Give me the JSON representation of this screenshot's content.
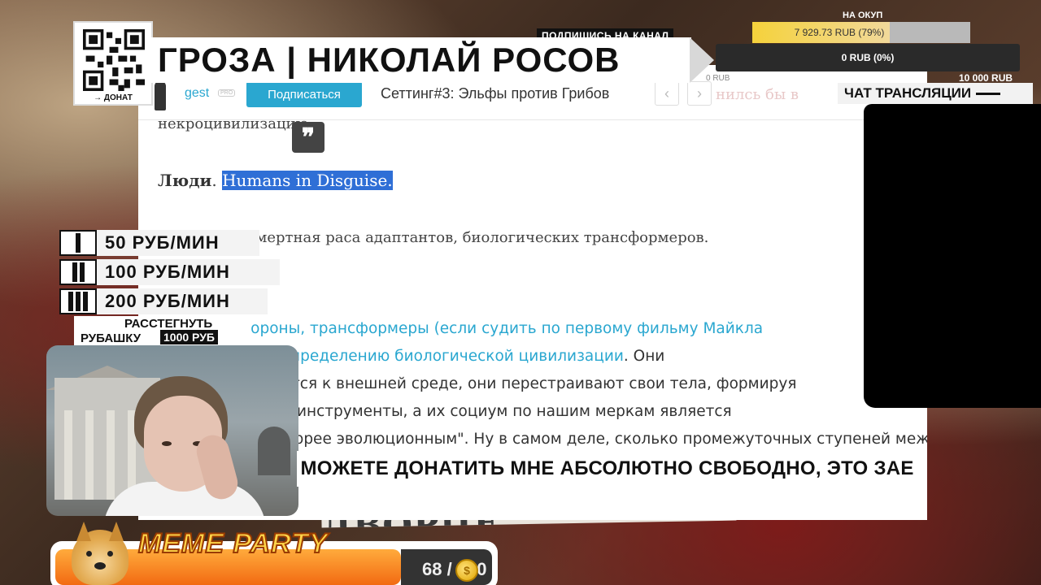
{
  "stream_title": "ГРОЗА | НИКОЛАЙ РОСОВ",
  "subscribe_tag": "ПОДПИШИСЬ НА КАНАЛ",
  "qr": {
    "label": "→ ДОНАТ"
  },
  "goals": {
    "caption": "НА ОКУП",
    "primary": {
      "text": "7 929.73 RUB (79%)",
      "progress": 0.79
    },
    "secondary": {
      "text": "0 RUB (0%)",
      "zero_label": "0 RUB",
      "total": "10 000 RUB"
    }
  },
  "chat": {
    "label": "ЧАТ ТРАНСЛЯЦИИ"
  },
  "tiers": [
    {
      "roman": "I",
      "price": "50 РУБ/МИН"
    },
    {
      "roman": "II",
      "price": "100 РУБ/МИН"
    },
    {
      "roman": "III",
      "price": "200 РУБ/МИН"
    }
  ],
  "shirt": {
    "line1": "РАССТЕГНУТЬ",
    "line2": "РУБАШКУ",
    "price": "1000 РУБ"
  },
  "ticker": {
    "text": "И МОЖЕТЕ ДОНАТИТЬ МНЕ АБСОЛЮТНО СВОБОДНО, ЭТО ЗАЕ"
  },
  "background_poster": {
    "text": "В ЗИМНЕМ ДВОРЦЕ"
  },
  "meme_party": {
    "title": "MEME PARTY",
    "count": "68 / 100",
    "progress": 0.68
  },
  "browser": {
    "nav": {
      "username": "gest",
      "badge": "PRO",
      "subscribe_label": "Подписаться",
      "article_title": "Сеттинг#3: Эльфы против Грибов",
      "prev": "‹",
      "next": "›",
      "faded_text": "нилсь бы в"
    },
    "content": {
      "line_necro": "некроцивилизацию.",
      "quote_icon": "❞",
      "people_label": "Люди",
      "people_period": ". ",
      "people_link": "Humans in Disguise.",
      "werewolves": "Оборотни - смертная раса адаптантов, биологических трансформеров.",
      "link_line1": "С другой стороны, трансформеры (если судить по первому фильму Майкла",
      "link_line2": "соответствуют определению биологической цивилизации",
      "after_link2": ". Они",
      "line3": "приспосабливаются к внешней среде, они перестраивают свои тела, формируя",
      "line4": "необходимые им инструменты, а их социум по нашим меркам является",
      "line5": "\"феодальным: скорее эволюционным\". Ну в самом деле, сколько промежуточных ступеней между"
    }
  },
  "colors": {
    "accent": "#2aa7d0",
    "highlight": "#2f6fd6",
    "goal_fill": "#f5d23b"
  }
}
